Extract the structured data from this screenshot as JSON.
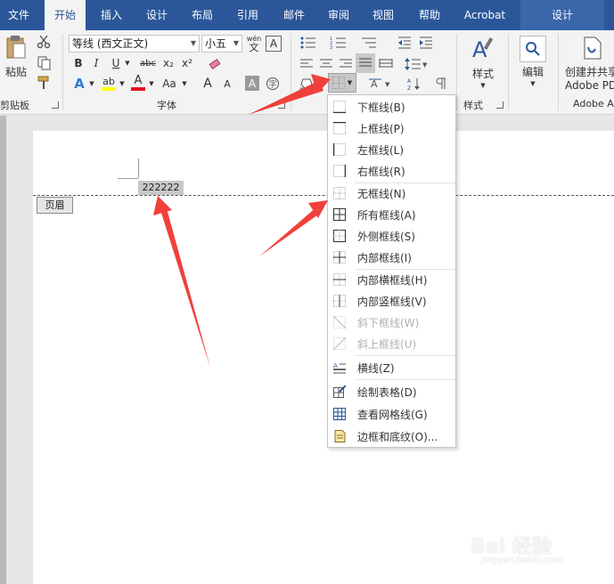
{
  "tabs": [
    "文件",
    "开始",
    "插入",
    "设计",
    "布局",
    "引用",
    "邮件",
    "审阅",
    "视图",
    "帮助",
    "Acrobat",
    "设计"
  ],
  "ribbon": {
    "paste_label": "粘贴",
    "clipboard_label": "剪贴板",
    "font_name": "等线 (西文正文)",
    "font_size": "小五",
    "font_group_label": "字体",
    "bold": "B",
    "italic": "I",
    "underline": "U",
    "strike": "abc",
    "subscript": "x₂",
    "superscript": "x²",
    "text_effect": "A",
    "highlight": "ab",
    "font_color": "A",
    "change_case": "Aa",
    "grow_font": "A",
    "shrink_font": "A",
    "char_shading": "A",
    "phonetic_top": "wén",
    "phonetic_bottom": "文",
    "char_border": "A",
    "styles_label": "样式",
    "styles_group_label": "样式",
    "editing_label": "编辑",
    "acrobat_label_1": "创建并共享",
    "acrobat_label_2": "Adobe PDF",
    "acrobat_group_label": "Adobe A"
  },
  "document": {
    "header_text": "222222",
    "header_tag": "页眉"
  },
  "border_menu": {
    "items": [
      {
        "label": "下框线(B)",
        "disabled": false
      },
      {
        "label": "上框线(P)",
        "disabled": false
      },
      {
        "label": "左框线(L)",
        "disabled": false
      },
      {
        "label": "右框线(R)",
        "disabled": false
      },
      {
        "label": "无框线(N)",
        "disabled": false
      },
      {
        "label": "所有框线(A)",
        "disabled": false
      },
      {
        "label": "外侧框线(S)",
        "disabled": false
      },
      {
        "label": "内部框线(I)",
        "disabled": false
      },
      {
        "label": "内部横框线(H)",
        "disabled": false
      },
      {
        "label": "内部竖框线(V)",
        "disabled": false
      },
      {
        "label": "斜下框线(W)",
        "disabled": true
      },
      {
        "label": "斜上框线(U)",
        "disabled": true
      },
      {
        "label": "横线(Z)",
        "disabled": false
      },
      {
        "label": "绘制表格(D)",
        "disabled": false
      },
      {
        "label": "查看网格线(G)",
        "disabled": false
      },
      {
        "label": "边框和底纹(O)...",
        "disabled": false
      }
    ]
  },
  "watermark": {
    "brand": "Bai 经验",
    "url": "jingyan.baidu.com"
  },
  "colors": {
    "ribbon_blue": "#2b579a",
    "arrow_red": "#f0403c",
    "highlight_yellow": "#ffff00",
    "font_red": "#e81123"
  }
}
